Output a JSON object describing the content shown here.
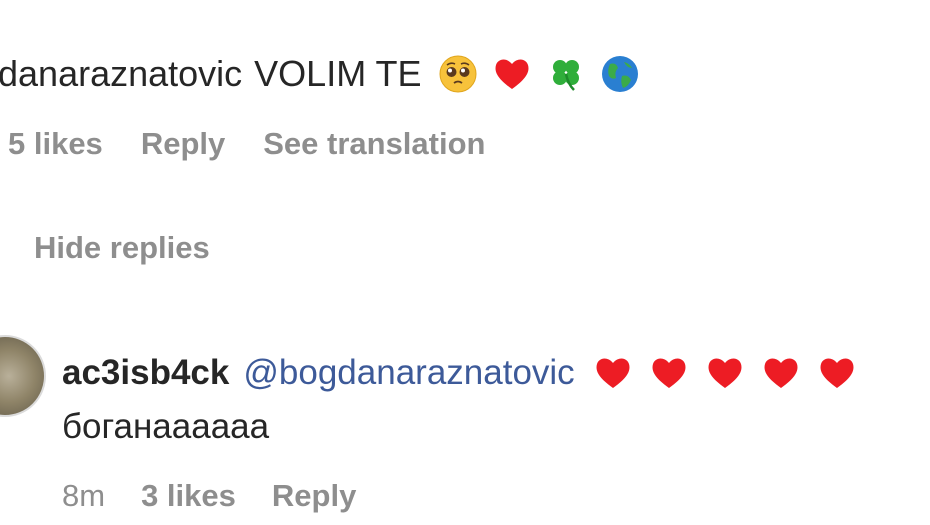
{
  "comment": {
    "username": "danaraznatovic",
    "text": "VOLIM TE",
    "emojis": [
      "pleading-face-icon",
      "red-heart-icon",
      "four-leaf-clover-icon",
      "globe-americas-icon"
    ],
    "likes": "5 likes",
    "reply_label": "Reply",
    "translate_label": "See translation"
  },
  "hide_replies_label": "Hide replies",
  "reply": {
    "username": "ac3isb4ck",
    "mention": "@bogdanaraznatovic",
    "text": "боганаааааа",
    "time": "8m",
    "likes": "3 likes",
    "reply_label": "Reply"
  },
  "colors": {
    "text": "#262626",
    "muted": "#8e8e8e",
    "mention": "#3d5a99",
    "heart": "#ed1c24"
  }
}
